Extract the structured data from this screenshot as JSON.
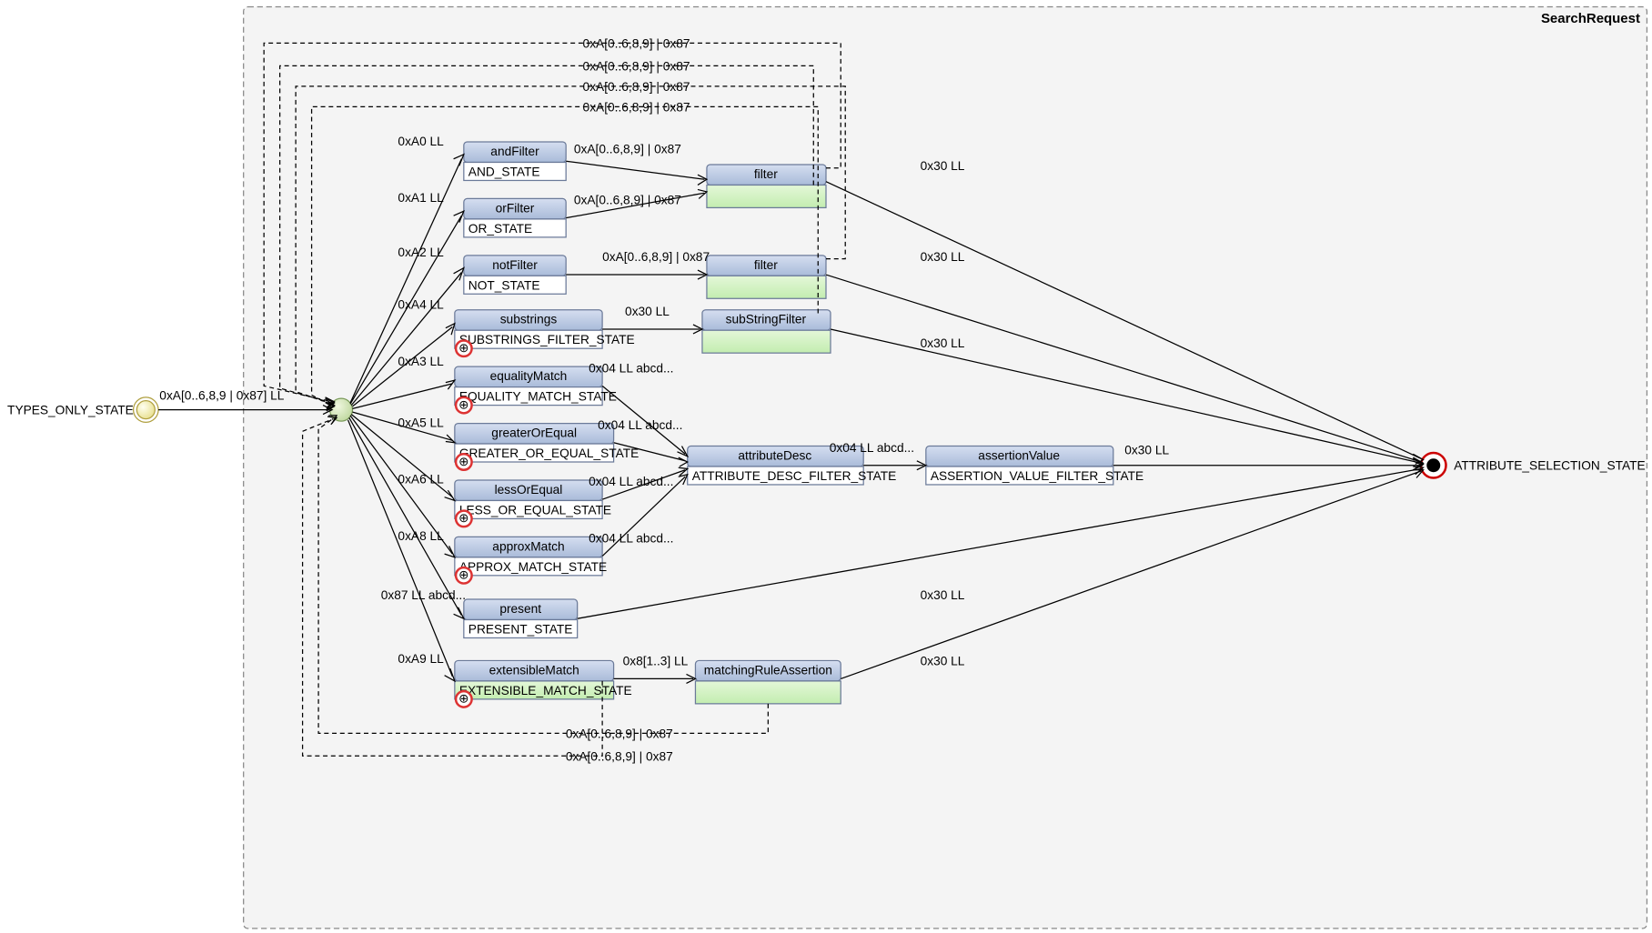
{
  "frame": {
    "title": "SearchRequest"
  },
  "start_label": "TYPES_ONLY_STATE",
  "end_label": "ATTRIBUTE_SELECTION_STATE",
  "start_edge_label": "0xA[0..6,8,9 | 0x87] LL",
  "loop_labels": {
    "top1": "0xA[0..6,8,9] | 0x87",
    "top2": "0xA[0..6,8,9] | 0x87",
    "top3": "0xA[0..6,8,9] | 0x87",
    "top4": "0xA[0..6,8,9] | 0x87",
    "bottom1": "0xA[0..6,8,9] | 0x87",
    "bottom2": "0xA[0..6,8,9] | 0x87"
  },
  "branch_labels": {
    "and": "0xA0 LL",
    "or": "0xA1 LL",
    "not": "0xA2 LL",
    "substrings": "0xA4 LL",
    "equality": "0xA3 LL",
    "greater": "0xA5 LL",
    "less": "0xA6 LL",
    "approx": "0xA8 LL",
    "present": "0x87 LL abcd...",
    "extensible": "0xA9 LL"
  },
  "mid_labels": {
    "and_filter": "0xA[0..6,8,9] | 0x87",
    "or_filter": "0xA[0..6,8,9] | 0x87",
    "not_filter": "0xA[0..6,8,9] | 0x87",
    "substrings_mid": "0x30 LL",
    "eq_mid": "0x04 LL abcd...",
    "ge_mid": "0x04 LL abcd...",
    "le_mid": "0x04 LL abcd...",
    "approx_mid": "0x04 LL abcd...",
    "attr_to_assert": "0x04 LL abcd...",
    "ext_mid": "0x8[1..3] LL"
  },
  "right_labels": {
    "and_out": "0x30 LL",
    "not_out": "0x30 LL",
    "sub_out": "0x30 LL",
    "assert_out": "0x30 LL",
    "present_out": "0x30 LL",
    "ext_out": "0x30 LL"
  },
  "nodes": {
    "andFilter": {
      "title": "andFilter",
      "body": "AND_STATE"
    },
    "orFilter": {
      "title": "orFilter",
      "body": "OR_STATE"
    },
    "notFilter": {
      "title": "notFilter",
      "body": "NOT_STATE"
    },
    "substrings": {
      "title": "substrings",
      "body": "SUBSTRINGS_FILTER_STATE"
    },
    "equalityMatch": {
      "title": "equalityMatch",
      "body": "EQUALITY_MATCH_STATE"
    },
    "greaterOrEqual": {
      "title": "greaterOrEqual",
      "body": "GREATER_OR_EQUAL_STATE"
    },
    "lessOrEqual": {
      "title": "lessOrEqual",
      "body": "LESS_OR_EQUAL_STATE"
    },
    "approxMatch": {
      "title": "approxMatch",
      "body": "APPROX_MATCH_STATE"
    },
    "present": {
      "title": "present",
      "body": "PRESENT_STATE"
    },
    "extensibleMatch": {
      "title": "extensibleMatch",
      "body": "EXTENSIBLE_MATCH_STATE"
    },
    "filter1": {
      "title": "filter"
    },
    "filter2": {
      "title": "filter"
    },
    "subStringFilter": {
      "title": "subStringFilter"
    },
    "attributeDesc": {
      "title": "attributeDesc",
      "body": "ATTRIBUTE_DESC_FILTER_STATE"
    },
    "assertionValue": {
      "title": "assertionValue",
      "body": "ASSERTION_VALUE_FILTER_STATE"
    },
    "matchingRuleAssertion": {
      "title": "matchingRuleAssertion"
    }
  }
}
